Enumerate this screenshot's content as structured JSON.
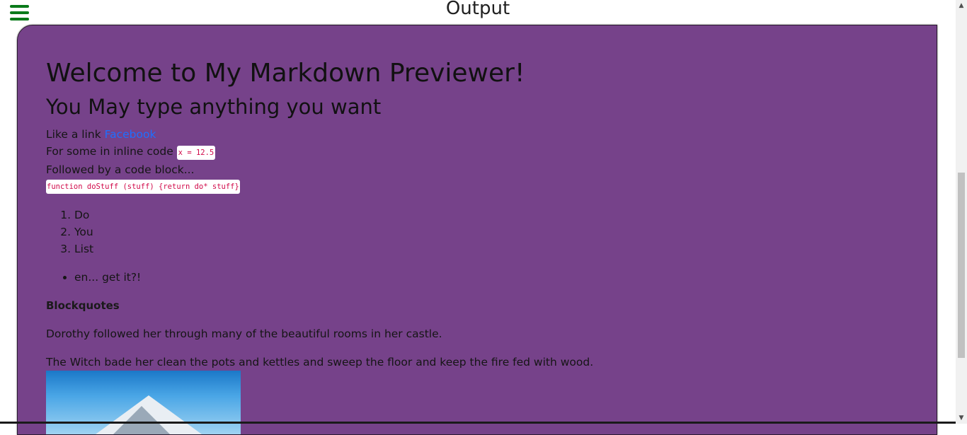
{
  "header": {
    "title": "Output",
    "menu_icon": "hamburger-icon"
  },
  "preview": {
    "h1": "Welcome to My Markdown Previewer!",
    "h2": "You May type anything you want",
    "link_prefix": "Like a link ",
    "link_text": "Facebook",
    "inline_prefix": "For some in inline code ",
    "inline_code": "x = 12.5",
    "block_intro": "Followed by a code block...",
    "code_block": "function doStuff (stuff) {return do* stuff}",
    "ordered_list": [
      "Do",
      "You",
      "List"
    ],
    "bullet_list": [
      "en... get it?!"
    ],
    "bold_text": "Blockquotes",
    "para1": "Dorothy followed her through many of the beautiful rooms in her castle.",
    "para2": "The Witch bade her clean the pots and kettles and sweep the floor and keep the fire fed with wood."
  },
  "colors": {
    "panel_bg": "#76428a",
    "menu_green": "#0a7a1a",
    "link": "#1e6fff",
    "code": "#d10a4a"
  }
}
